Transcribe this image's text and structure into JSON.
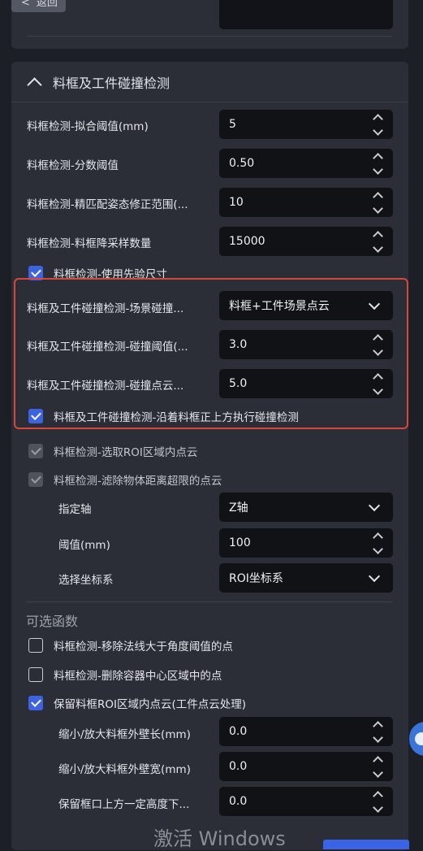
{
  "back_button": {
    "label": "返回"
  },
  "panel": {
    "title": "料框及工件碰撞检测",
    "rows": [
      {
        "label": "料框检测-拟合阈值(mm)",
        "value": "5"
      },
      {
        "label": "料框检测-分数阈值",
        "value": "0.50"
      },
      {
        "label": "料框检测-精匹配姿态修正范围(...",
        "value": "10"
      },
      {
        "label": "料框检测-料框降采样数量",
        "value": "15000"
      }
    ],
    "use_prior_size": {
      "label": "料框检测-使用先验尺寸",
      "checked": true
    },
    "collision": {
      "scene_label": "料框及工件碰撞检测-场景碰撞...",
      "scene_value": "料框+工件场景点云",
      "threshold_label": "料框及工件碰撞检测-碰撞阈值(...",
      "threshold_value": "3.0",
      "pointcloud_label": "料框及工件碰撞检测-碰撞点云...",
      "pointcloud_value": "5.0",
      "above_check_label": "料框及工件碰撞检测-沿着料框正上方执行碰撞检测",
      "above_check_checked": true
    },
    "roi_points": {
      "label": "料框检测-选取ROI区域内点云",
      "checked": true
    },
    "filter_distance": {
      "label": "料框检测-滤除物体距离超限的点云",
      "checked": true
    },
    "axis": {
      "label": "指定轴",
      "value": "Z轴"
    },
    "threshold": {
      "label": "阈值(mm)",
      "value": "100"
    },
    "coord_system": {
      "label": "选择坐标系",
      "value": "ROI坐标系"
    },
    "optional_title": "可选函数",
    "remove_normals": {
      "label": "料框检测-移除法线大于角度阈值的点",
      "checked": false
    },
    "remove_center": {
      "label": "料框检测-删除容器中心区域中的点",
      "checked": false
    },
    "keep_roi": {
      "label": "保留料框ROI区域内点云(工件点云处理)",
      "checked": true
    },
    "shrink_length": {
      "label": "缩小/放大料框外壁长(mm)",
      "value": "0.0"
    },
    "shrink_width": {
      "label": "缩小/放大料框外壁宽(mm)",
      "value": "0.0"
    },
    "keep_height": {
      "label": "保留框口上方一定高度下...",
      "value": "0.0"
    }
  },
  "watermark": "激活 Windows",
  "colors": {
    "accent": "#3d63e0",
    "highlight": "#d8473c",
    "panel": "#2b2e36"
  }
}
